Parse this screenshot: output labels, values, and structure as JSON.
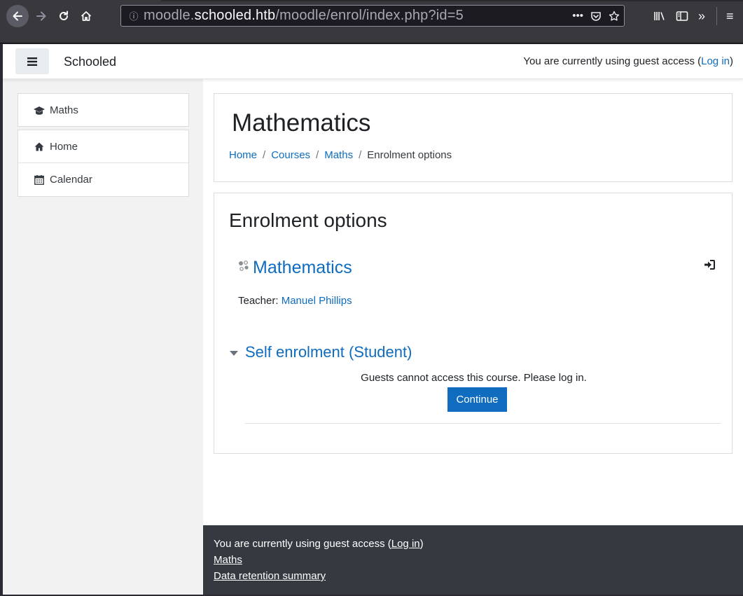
{
  "browser": {
    "url_host": "moodle.schooled.htb",
    "url_path": "/moodle/enrol/index.php?id=5",
    "url_prefix": "moodle.",
    "url_host_bold": "schooled.htb"
  },
  "navbar": {
    "brand": "Schooled",
    "guest_text": "You are currently using guest access (",
    "login_label": "Log in",
    "guest_close": ")"
  },
  "drawer": {
    "course_item": "Maths",
    "items": [
      {
        "label": "Home",
        "icon": "home-icon"
      },
      {
        "label": "Calendar",
        "icon": "calendar-icon"
      }
    ]
  },
  "header": {
    "title": "Mathematics",
    "breadcrumb": [
      "Home",
      "Courses",
      "Maths",
      "Enrolment options"
    ],
    "separator": "/"
  },
  "content": {
    "heading": "Enrolment options",
    "course_name": "Mathematics",
    "teacher_label": "Teacher: ",
    "teacher_name": "Manuel Phillips",
    "self_enrol_title": "Self enrolment (Student)",
    "guest_message": "Guests cannot access this course. Please log in.",
    "continue_label": "Continue"
  },
  "footer": {
    "guest_text": "You are currently using guest access (",
    "login_label": "Log in",
    "guest_close": ")",
    "maths_link": "Maths",
    "data_retention": "Data retention summary"
  },
  "colors": {
    "link": "#0f6cbf",
    "footer_bg": "#343a40",
    "drawer_bg": "#f2f2f2"
  }
}
